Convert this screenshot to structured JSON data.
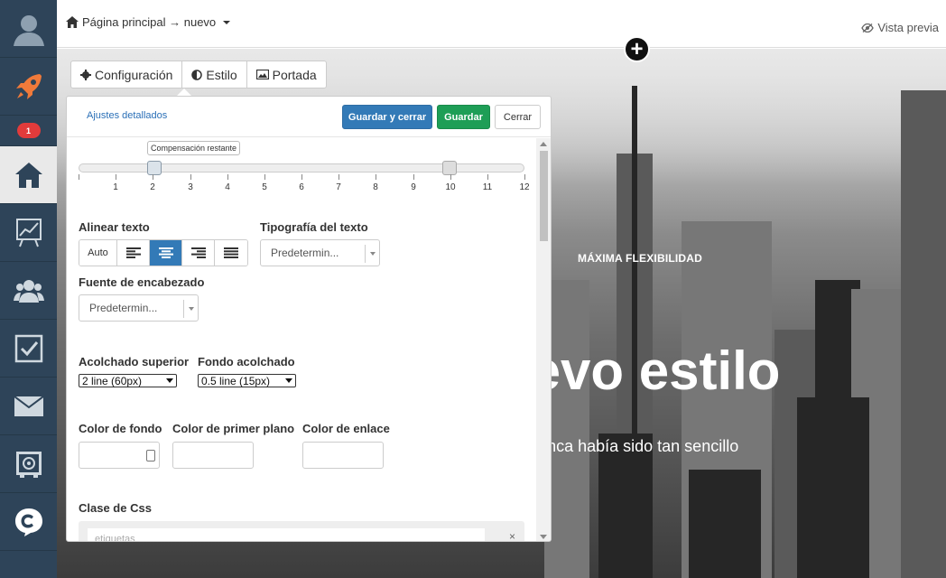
{
  "sidebar": {
    "items": [
      {
        "name": "avatar-icon"
      },
      {
        "name": "rocket-icon"
      },
      {
        "name": "home-icon",
        "active": true
      },
      {
        "name": "chart-icon"
      },
      {
        "name": "users-icon"
      },
      {
        "name": "checkbox-icon"
      },
      {
        "name": "mail-icon"
      },
      {
        "name": "safe-icon"
      },
      {
        "name": "chat-logo-icon"
      }
    ],
    "badge": "1"
  },
  "topbar": {
    "breadcrumb": "Página principal → nuevo",
    "preview": "Vista previa"
  },
  "tabs": [
    {
      "label": "Configuración",
      "icon": "gear-icon"
    },
    {
      "label": "Estilo",
      "icon": "contrast-icon",
      "active": true
    },
    {
      "label": "Portada",
      "icon": "image-icon"
    }
  ],
  "panel": {
    "advanced_link": "Ajustes detallados",
    "save_close": "Guardar y cerrar",
    "save": "Guardar",
    "close": "Cerrar",
    "slider": {
      "tooltip": "Compensación restante",
      "ticks": [
        "1",
        "2",
        "3",
        "4",
        "5",
        "6",
        "7",
        "8",
        "9",
        "10",
        "11",
        "12"
      ],
      "value_start": 2,
      "value_end": 10
    },
    "align_label": "Alinear texto",
    "align_auto": "Auto",
    "align_active": "center",
    "text_font_label": "Tipografía del texto",
    "text_font_value": "Predetermin...",
    "heading_font_label": "Fuente de encabezado",
    "heading_font_value": "Predetermin...",
    "padding_top_label": "Acolchado superior",
    "padding_top_value": "2 line (60px)",
    "padding_bottom_label": "Fondo acolchado",
    "padding_bottom_value": "0.5 line (15px)",
    "bg_color_label": "Color de fondo",
    "fg_color_label": "Color de primer plano",
    "link_color_label": "Color de enlace",
    "css_class_label": "Clase de Css",
    "tags_placeholder": "etiquetas",
    "tags_clear": "×"
  },
  "hero": {
    "eyebrow": "MÁXIMA FLEXIBILIDAD",
    "title": "uevo estilo",
    "subtitle": "ágina nunca había sido tan sencillo",
    "add": "+"
  }
}
